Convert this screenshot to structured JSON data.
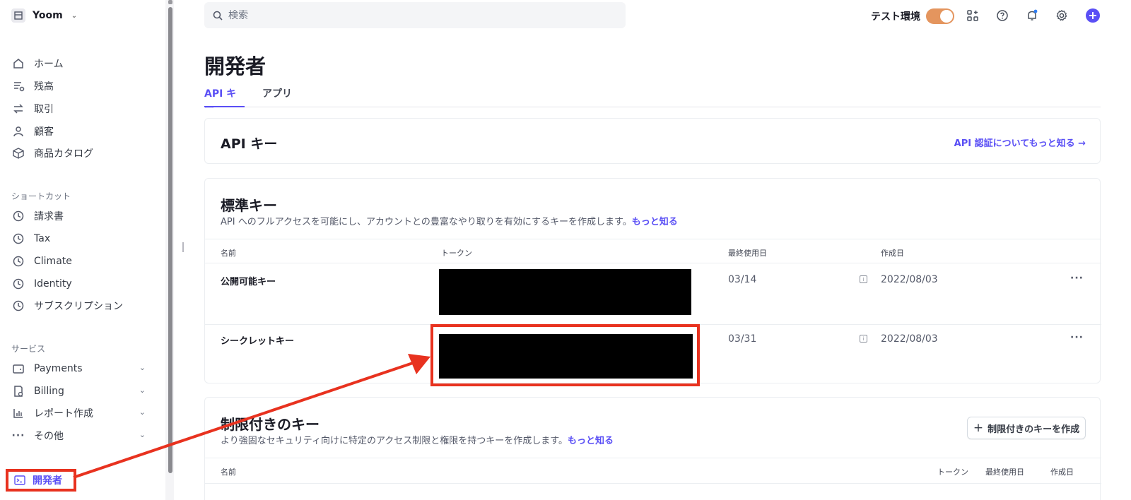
{
  "account": {
    "name": "Yoom"
  },
  "sidebar": {
    "primary": [
      {
        "label": "ホーム",
        "icon": "home-icon"
      },
      {
        "label": "残高",
        "icon": "balance-icon"
      },
      {
        "label": "取引",
        "icon": "transactions-icon"
      },
      {
        "label": "顧客",
        "icon": "customer-icon"
      },
      {
        "label": "商品カタログ",
        "icon": "product-catalog-icon"
      }
    ],
    "shortcuts_title": "ショートカット",
    "shortcuts": [
      {
        "label": "請求書",
        "icon": "clock-icon"
      },
      {
        "label": "Tax",
        "icon": "clock-icon"
      },
      {
        "label": "Climate",
        "icon": "clock-icon"
      },
      {
        "label": "Identity",
        "icon": "clock-icon"
      },
      {
        "label": "サブスクリプション",
        "icon": "clock-icon"
      }
    ],
    "services_title": "サービス",
    "services": [
      {
        "label": "Payments",
        "icon": "wallet-icon"
      },
      {
        "label": "Billing",
        "icon": "billing-icon"
      },
      {
        "label": "レポート作成",
        "icon": "reports-icon"
      },
      {
        "label": "その他",
        "icon": "more-dots-icon"
      }
    ],
    "developer": {
      "label": "開発者",
      "icon": "terminal-icon"
    }
  },
  "topbar": {
    "search_placeholder": "検索",
    "test_mode_label": "テスト環境",
    "test_mode_on": true
  },
  "page": {
    "title": "開発者",
    "tabs": [
      "API キー",
      "アプリ"
    ],
    "active_tab": "API キー"
  },
  "api_card": {
    "title": "API キー",
    "link": "API 認証についてもっと知る →"
  },
  "standard_keys": {
    "title": "標準キー",
    "description": "API へのフルアクセスを可能にし、アカウントとの豊富なやり取りを有効にするキーを作成します。",
    "learn_more": "もっと知る",
    "columns": [
      "名前",
      "トークン",
      "最終使用日",
      "作成日"
    ],
    "rows": [
      {
        "name": "公開可能キー",
        "last_used": "03/14",
        "created": "2022/08/03",
        "more": "···"
      },
      {
        "name": "シークレットキー",
        "last_used": "03/31",
        "created": "2022/08/03",
        "more": "···"
      }
    ]
  },
  "restricted_keys": {
    "title": "制限付きのキー",
    "description": "より強固なセキュリティ向けに特定のアクセス制限と権限を持つキーを作成します。",
    "learn_more": "もっと知る",
    "create_button": "制限付きのキーを作成",
    "columns": [
      "名前",
      "トークン",
      "最終使用日",
      "作成日"
    ]
  },
  "colors": {
    "accent": "#5a4ff5",
    "annotation": "#e8321f",
    "toggle": "#e4955e"
  }
}
